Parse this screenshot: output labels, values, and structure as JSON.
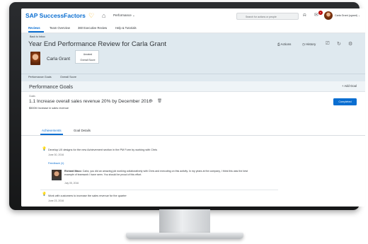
{
  "shell": {
    "brand": "SAP SuccessFactors",
    "module_selector": "Performance ⌄",
    "search_placeholder": "Search for actions or people",
    "notification_count": "6",
    "user_name": "Carla Grant (cgrant) ⌄"
  },
  "subnav": {
    "items": [
      "Reviews",
      "Team Overview",
      "360 Executive Review",
      "Help & Tutorials"
    ]
  },
  "header": {
    "back_link": "Back to Inbox",
    "title": "Year End Performance Review for Carla Grant",
    "actions_label": "Actions",
    "history_label": "History",
    "person_name": "Carla Grant",
    "overall_rating_value": "Unrated",
    "overall_rating_label": "Overall Score",
    "tabs": [
      "Performance Goals",
      "Overall Score"
    ]
  },
  "section": {
    "title": "Performance Goals",
    "add_goal_label": "+ Add Goal"
  },
  "goal": {
    "label": "Goals",
    "title": "1.1 Increase overall sales revenue 20% by December 2016",
    "metric": "$500M Increase in sales revenue",
    "status_button": "Completed"
  },
  "tabs": [
    "Achievements",
    "Goal Details"
  ],
  "achievements": [
    {
      "text": "Develop UX designs for the new Achievement section in the PM Form by working with Chris",
      "date": "June 30, 2016"
    },
    {
      "text": "Work with customers to increase the sales revenue for the quarter",
      "date": "June 23, 2016"
    }
  ],
  "feedback": {
    "link": "Feedback (1)",
    "author": "Richard Maco:",
    "text": "Carla, you did an amazing job working collaboratively with Chris and executing on this activity.  In my years at the company, I think this was the best example of teamwork I have seen.  You should be proud of this effort.",
    "date": "July 05, 2016"
  },
  "colors": {
    "accent": "#0a6ed1",
    "header_bg": "#dfe9ef",
    "achievement_icon": "#e9a400"
  },
  "icons": [
    "home-icon",
    "search-icon",
    "bell-icon",
    "notification-icon",
    "edit-icon",
    "delete-icon",
    "lightbulb-icon"
  ]
}
